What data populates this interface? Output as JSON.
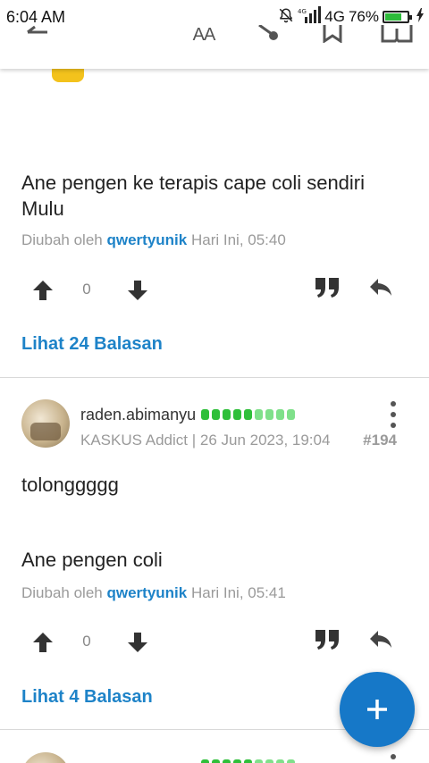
{
  "status_bar": {
    "time": "6:04 AM",
    "network": "4G",
    "battery": "76%",
    "battery_level": 0.76,
    "icons": [
      "mute-bell-icon",
      "signal-icon",
      "battery-icon",
      "charging-icon"
    ]
  },
  "toolbar": {
    "font_size_label": "AA",
    "icons": [
      "back-icon",
      "font-size-icon",
      "share-icon",
      "bookmark-icon",
      "book-icon"
    ]
  },
  "posts": [
    {
      "text_lines": [
        "Ane pengen ke terapis cape coli sendiri",
        "Mulu"
      ],
      "edited_prefix": "Diubah oleh",
      "edited_user": "qwertyunik",
      "edited_time": "Hari Ini, 05:40",
      "vote_count": "0",
      "replies_label": "Lihat 24 Balasan"
    },
    {
      "username": "raden.abimanyu",
      "reputation_bars": 9,
      "meta": "KASKUS Addict | 26 Jun 2023, 19:04",
      "post_number": "#194",
      "text_lines": [
        "tolonggggg",
        "",
        "",
        "Ane pengen coli"
      ],
      "edited_prefix": "Diubah oleh",
      "edited_user": "qwertyunik",
      "edited_time": "Hari Ini, 05:41",
      "vote_count": "0",
      "replies_label": "Lihat 4 Balasan"
    }
  ],
  "colors": {
    "accent": "#1e83c8",
    "fab": "#1678c8",
    "reputation": "#2fbf3a",
    "muted": "#9a9a9a"
  },
  "fab": {
    "icon": "plus-icon"
  }
}
